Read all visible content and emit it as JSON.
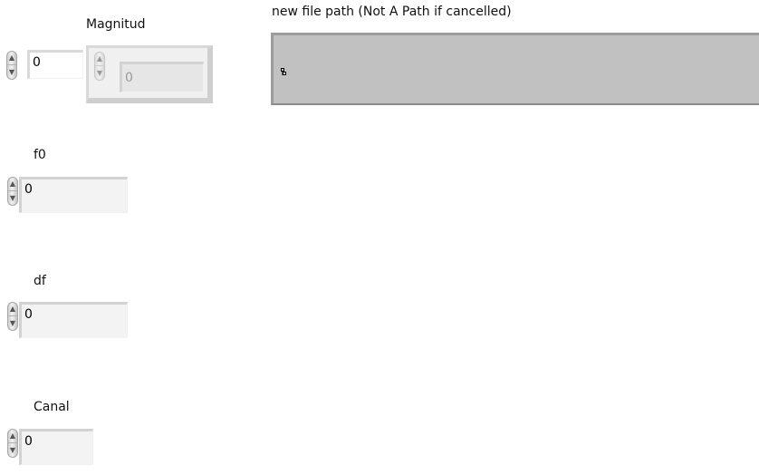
{
  "controls": {
    "unnamed_numeric": {
      "value": "0"
    },
    "magnitud": {
      "label": "Magnitud",
      "value": "0"
    },
    "new_file_path": {
      "label": "new file path (Not A Path if cancelled)",
      "value": ""
    },
    "f0": {
      "label": "f0",
      "value": "0"
    },
    "df": {
      "label": "df",
      "value": "0"
    },
    "canal": {
      "label": "Canal",
      "value": "0"
    }
  },
  "icons": {
    "spinner_up": "▲",
    "spinner_down": "▼",
    "path_browse": "path-icon"
  }
}
